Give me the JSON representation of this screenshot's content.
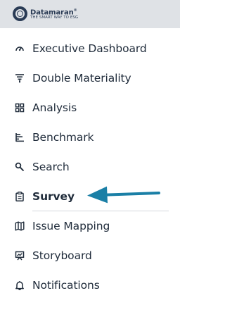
{
  "brand": {
    "name": "Datamaran",
    "registered": "®",
    "tagline": "THE SMART WAY TO ESG"
  },
  "nav": {
    "items": [
      {
        "label": "Executive Dashboard",
        "icon": "gauge-icon"
      },
      {
        "label": "Double Materiality",
        "icon": "filter-bars-icon"
      },
      {
        "label": "Analysis",
        "icon": "grid-icon"
      },
      {
        "label": "Benchmark",
        "icon": "bar-chart-icon"
      },
      {
        "label": "Search",
        "icon": "search-icon"
      },
      {
        "label": "Survey",
        "icon": "clipboard-icon",
        "active": true
      },
      {
        "label": "Issue Mapping",
        "icon": "map-icon"
      },
      {
        "label": "Storyboard",
        "icon": "presentation-icon"
      },
      {
        "label": "Notifications",
        "icon": "bell-icon"
      }
    ]
  },
  "colors": {
    "brand_bar": "#dfe2e6",
    "brand_dark": "#2a3b55",
    "text": "#1f2b3a",
    "arrow": "#1a7fa6"
  }
}
